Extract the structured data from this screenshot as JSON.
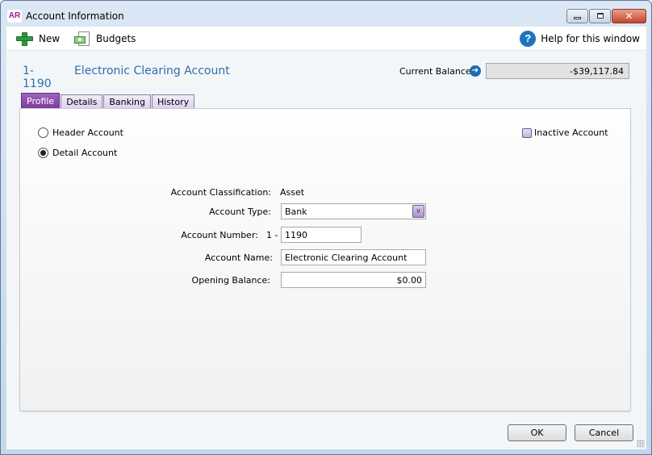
{
  "window": {
    "app_icon_text": "AR",
    "title": "Account Information",
    "controls": {
      "minimize": "minimize",
      "maximize": "maximize",
      "close": "✕"
    }
  },
  "toolbar": {
    "new_label": "New",
    "budgets_label": "Budgets",
    "help_label": "Help for this window",
    "help_glyph": "?"
  },
  "account_header": {
    "number": "1-1190",
    "name": "Electronic Clearing Account",
    "balance_label": "Current Balance:",
    "balance_arrow": "➔",
    "balance_value": "-$39,117.84"
  },
  "tabs": [
    {
      "label": "Profile",
      "active": true
    },
    {
      "label": "Details",
      "active": false
    },
    {
      "label": "Banking",
      "active": false
    },
    {
      "label": "History",
      "active": false
    }
  ],
  "profile": {
    "radio_header": {
      "label": "Header Account",
      "checked": false
    },
    "radio_detail": {
      "label": "Detail Account",
      "checked": true
    },
    "inactive": {
      "label": "Inactive Account",
      "checked": false
    },
    "classification_label": "Account Classification:",
    "classification_value": "Asset",
    "type_label": "Account Type:",
    "type_value": "Bank",
    "type_dropdown_glyph": "∨",
    "number_label": "Account Number:",
    "number_prefix": "1 -",
    "number_value": "1190",
    "name_label": "Account Name:",
    "name_value": "Electronic Clearing Account",
    "opening_label": "Opening Balance:",
    "opening_value": "$0.00"
  },
  "footer": {
    "ok_label": "OK",
    "cancel_label": "Cancel"
  }
}
